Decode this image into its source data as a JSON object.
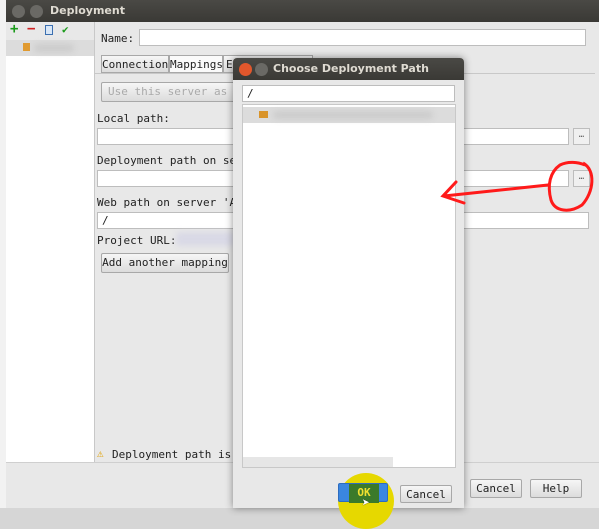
{
  "main_window": {
    "title": "Deployment",
    "name_label": "Name:",
    "tabs": [
      "Connection",
      "Mappings",
      "E"
    ],
    "use_default_label": "Use this server as de",
    "local_path_label": "Local path:",
    "deployment_path_label": "Deployment path on serv",
    "web_path_label": "Web path on server 'Ali",
    "web_path_value": "/",
    "project_url_label": "Project URL:",
    "add_mapping_label": "Add another mapping",
    "warning": "Deployment path is no",
    "cancel_label": "Cancel",
    "help_label": "Help"
  },
  "dialog": {
    "title": "Choose Deployment Path",
    "path_value": "/",
    "ok_label": "OK",
    "cancel_label": "Cancel"
  },
  "colors": {
    "annotation": "#ff1a1a",
    "highlight": "#e6d800",
    "ok_button": "#3a86e0"
  }
}
